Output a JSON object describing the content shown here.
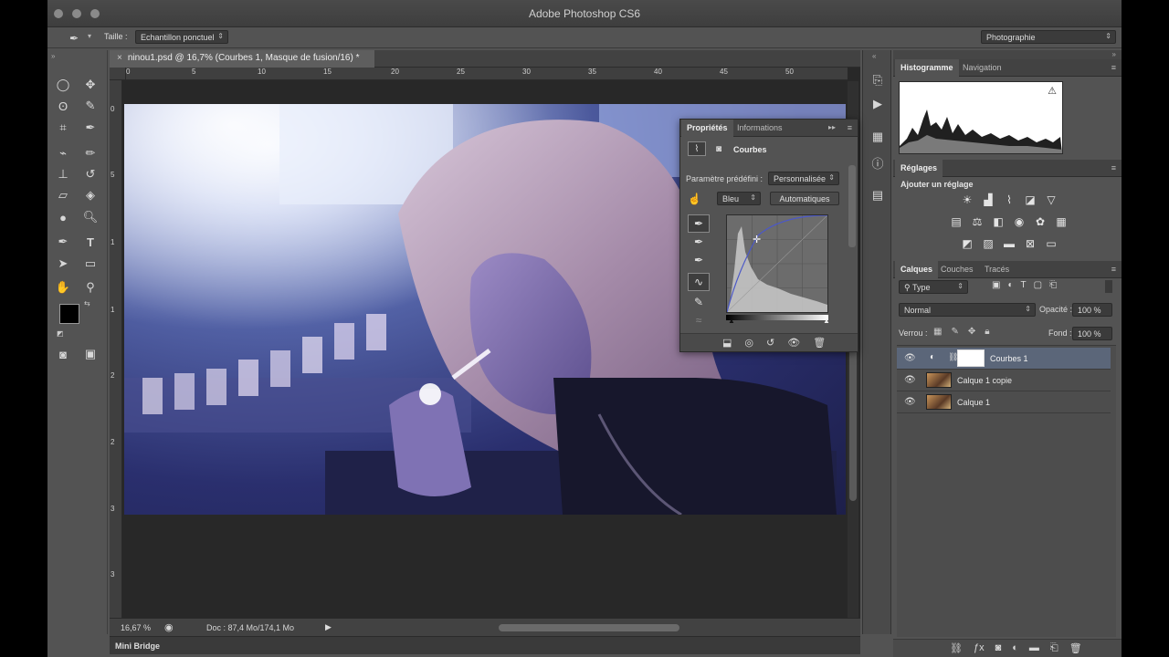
{
  "window": {
    "title": "Adobe Photoshop CS6"
  },
  "options_bar": {
    "size_label": "Taille :",
    "sample_select": "Echantillon ponctuel",
    "workspace_select": "Photographie"
  },
  "document": {
    "tab_title": "ninou1.psd @ 16,7% (Courbes 1, Masque de fusion/16) *",
    "ruler_h": [
      "0",
      "5",
      "10",
      "15",
      "20",
      "25",
      "30",
      "35",
      "40",
      "45",
      "50"
    ],
    "ruler_v": [
      "0",
      "5",
      "1",
      "1",
      "2",
      "2",
      "3",
      "3"
    ],
    "zoom": "16,67 %",
    "doc_info": "Doc : 87,4 Mo/174,1 Mo"
  },
  "mini_bridge": {
    "label": "Mini Bridge"
  },
  "histogram_panel": {
    "tabs": [
      "Histogramme",
      "Navigation"
    ],
    "warning": "⚠"
  },
  "adjustments_panel": {
    "title": "Réglages",
    "add_label": "Ajouter un réglage"
  },
  "layers_panel": {
    "tabs": [
      "Calques",
      "Couches",
      "Tracés"
    ],
    "filter_select": "Type",
    "blend_mode": "Normal",
    "opacity_label": "Opacité :",
    "opacity_value": "100 %",
    "lock_label": "Verrou :",
    "fill_label": "Fond :",
    "fill_value": "100 %",
    "layers": [
      {
        "name": "Courbes 1",
        "selected": true,
        "type": "adjustment"
      },
      {
        "name": "Calque 1 copie",
        "selected": false,
        "type": "image"
      },
      {
        "name": "Calque 1",
        "selected": false,
        "type": "image"
      }
    ]
  },
  "properties_panel": {
    "tabs": [
      "Propriétés",
      "Informations"
    ],
    "title": "Courbes",
    "preset_label": "Paramètre prédéfini :",
    "preset_value": "Personnalisée",
    "channel_value": "Bleu",
    "auto_button": "Automatiques"
  },
  "colors": {
    "foreground": "#000000",
    "background": "#ffffff",
    "selection": "#5b6679"
  }
}
